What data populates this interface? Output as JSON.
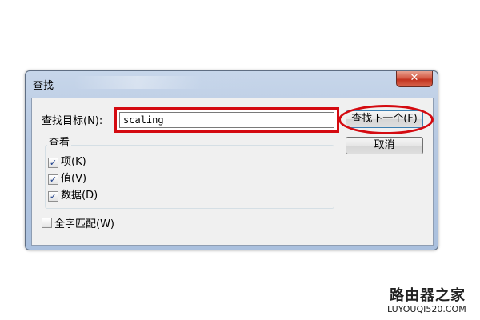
{
  "dialog": {
    "title": "查找",
    "close_glyph": "✕",
    "find_target_label": "查找目标(N):",
    "search_value": "scaling",
    "find_next_label": "查找下一个(F)",
    "cancel_label": "取消",
    "look_in": {
      "title": "查看",
      "options": [
        {
          "label": "项(K)",
          "checked": true
        },
        {
          "label": "值(V)",
          "checked": true
        },
        {
          "label": "数据(D)",
          "checked": true
        }
      ]
    },
    "match_whole": {
      "label": "全字匹配(W)",
      "checked": false
    }
  },
  "watermark": {
    "logo": "路由器之家",
    "url": "LUYOUQI520.COM"
  },
  "colors": {
    "highlight": "#d40a10",
    "title_bar": "#b6c8e1"
  }
}
